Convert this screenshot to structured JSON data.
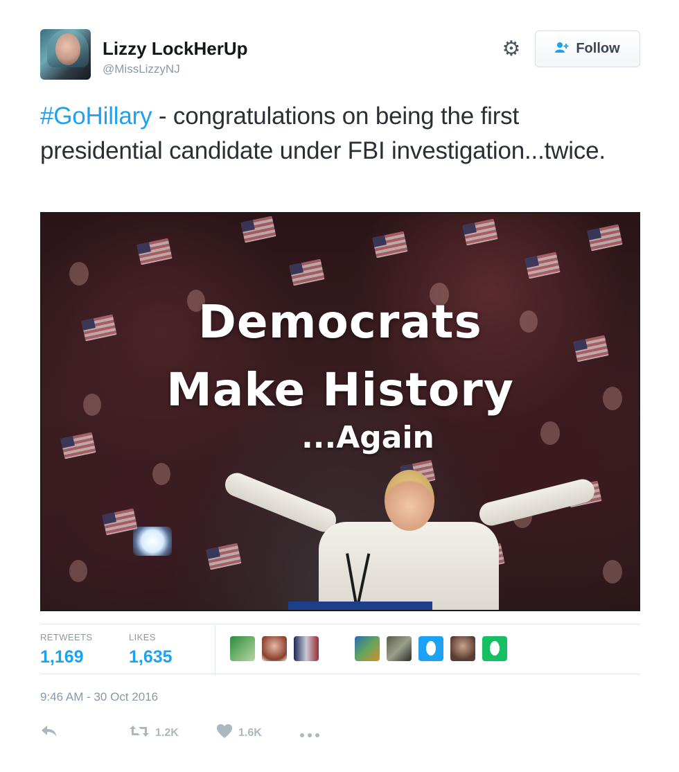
{
  "user": {
    "display_name": "Lizzy LockHerUp",
    "handle": "@MissLizzyNJ"
  },
  "follow_button": {
    "label": "Follow"
  },
  "tweet": {
    "hashtag": "#GoHillary",
    "text": " - congratulations on being the first presidential candidate under FBI investigation...twice."
  },
  "media": {
    "line1": "Democrats",
    "line2": "Make History",
    "line3": "...Again"
  },
  "stats": {
    "retweets_label": "RETWEETS",
    "retweets_value": "1,169",
    "likes_label": "LIKES",
    "likes_value": "1,635"
  },
  "timestamp": "9:46 AM - 30 Oct 2016",
  "actions": {
    "retweet_count": "1.2K",
    "like_count": "1.6K"
  },
  "icons": {
    "gear": "gear-icon",
    "follow": "add-user-icon",
    "reply": "reply-icon",
    "retweet": "retweet-icon",
    "like": "heart-icon",
    "more": "more-icon"
  },
  "colors": {
    "accent": "#1da1f2",
    "muted": "#8899a6",
    "text": "#292f33"
  }
}
